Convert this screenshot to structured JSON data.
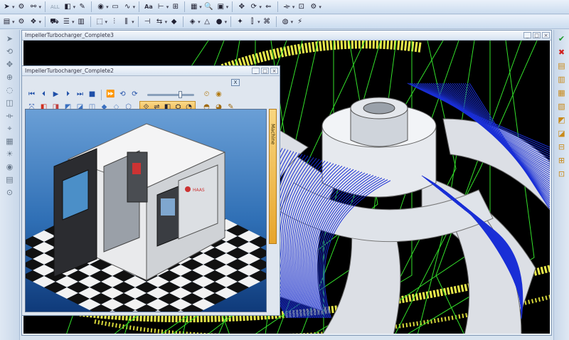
{
  "toolbar1": {
    "items": [
      {
        "name": "pointer-icon",
        "glyph": "➤"
      },
      {
        "name": "select-filter-icon",
        "glyph": "⚙"
      },
      {
        "name": "link-icon",
        "glyph": "⚯"
      },
      {
        "name": "all-filter",
        "glyph": "ALL"
      },
      {
        "name": "curve-icon",
        "glyph": "◧"
      },
      {
        "name": "pen-icon",
        "glyph": "✎"
      },
      {
        "name": "circle-icon",
        "glyph": "◉"
      },
      {
        "name": "rect-icon",
        "glyph": "▭"
      },
      {
        "name": "spline-icon",
        "glyph": "∿"
      },
      {
        "name": "text-tool",
        "glyph": "Aa"
      },
      {
        "name": "split-icon",
        "glyph": "⊢"
      },
      {
        "name": "table-icon",
        "glyph": "⊞"
      },
      {
        "name": "hatch-icon",
        "glyph": "▦"
      },
      {
        "name": "search-icon",
        "glyph": "🔍"
      },
      {
        "name": "layers-icon",
        "glyph": "▣"
      },
      {
        "name": "move-icon",
        "glyph": "✥"
      },
      {
        "name": "refresh-icon",
        "glyph": "⟳"
      },
      {
        "name": "arrow-left-icon",
        "glyph": "⇐"
      },
      {
        "name": "measure-icon",
        "glyph": "⟛"
      },
      {
        "name": "zoom-window-icon",
        "glyph": "⊡"
      },
      {
        "name": "settings-icon",
        "glyph": "⚙"
      }
    ]
  },
  "toolbar2": {
    "items": [
      {
        "name": "layout-icon",
        "glyph": "▤"
      },
      {
        "name": "gear-icon",
        "glyph": "⚙"
      },
      {
        "name": "group-icon",
        "glyph": "❖"
      },
      {
        "name": "car-icon",
        "glyph": "⛟"
      },
      {
        "name": "stack-icon",
        "glyph": "☰"
      },
      {
        "name": "mesh-icon",
        "glyph": "▥"
      },
      {
        "name": "view-icon",
        "glyph": "⬚"
      },
      {
        "name": "align-icon",
        "glyph": "⫶"
      },
      {
        "name": "columns-icon",
        "glyph": "⫼"
      },
      {
        "name": "lock-icon",
        "glyph": "⊣"
      },
      {
        "name": "mirror-icon",
        "glyph": "⇆"
      },
      {
        "name": "cube-icon",
        "glyph": "◆"
      },
      {
        "name": "shade-icon",
        "glyph": "◈"
      },
      {
        "name": "triangle-icon",
        "glyph": "△"
      },
      {
        "name": "record-icon",
        "glyph": "●"
      },
      {
        "name": "sparkle-icon",
        "glyph": "✦"
      },
      {
        "name": "sliders-icon",
        "glyph": "⫿"
      },
      {
        "name": "tree-icon",
        "glyph": "⌘"
      },
      {
        "name": "globe-icon",
        "glyph": "◍"
      },
      {
        "name": "bolt-icon",
        "glyph": "⚡"
      }
    ]
  },
  "main_window": {
    "title": "ImpellerTurbocharger_Complete3",
    "controls": [
      "_",
      "□",
      "×"
    ]
  },
  "sub_window": {
    "title": "ImpellerTurbocharger_Complete2",
    "controls": [
      "_",
      "□",
      "×"
    ],
    "x_button": "X",
    "side_tab": "Machine",
    "playback": [
      {
        "name": "skip-start-icon",
        "glyph": "⏮"
      },
      {
        "name": "step-back-icon",
        "glyph": "⏴"
      },
      {
        "name": "play-icon",
        "glyph": "▶"
      },
      {
        "name": "step-forward-icon",
        "glyph": "⏵"
      },
      {
        "name": "skip-end-icon",
        "glyph": "⏭"
      },
      {
        "name": "stop-icon",
        "glyph": "■"
      },
      {
        "name": "fast-forward-icon",
        "glyph": "⏩"
      },
      {
        "name": "loop-icon",
        "glyph": "⟲"
      },
      {
        "name": "cycle-icon",
        "glyph": "⟳"
      }
    ],
    "views": [
      {
        "name": "fit-view-icon",
        "glyph": "⤧"
      },
      {
        "name": "cube-front-icon",
        "glyph": "◧"
      },
      {
        "name": "cube-top-icon",
        "glyph": "◨"
      },
      {
        "name": "cube-right-icon",
        "glyph": "◩"
      },
      {
        "name": "cube-left-icon",
        "glyph": "◪"
      },
      {
        "name": "cube-back-icon",
        "glyph": "◫"
      },
      {
        "name": "cube-iso-icon",
        "glyph": "◆"
      },
      {
        "name": "cube-bottom-icon",
        "glyph": "◇"
      },
      {
        "name": "cube-wire-icon",
        "glyph": "⬡"
      }
    ],
    "machine": {
      "brand": "HAAS"
    }
  },
  "left_tools": [
    "pointer-tool-icon",
    "rotate-tool-icon",
    "pan-tool-icon",
    "zoom-tool-icon",
    "orbit-tool-icon",
    "section-tool-icon",
    "measure-tool-icon",
    "snap-tool-icon",
    "grid-tool-icon",
    "light-tool-icon",
    "camera-tool-icon",
    "layer-tool-icon",
    "probe-tool-icon"
  ],
  "right_tools": [
    {
      "name": "ok-check-icon",
      "glyph": "✔",
      "color": "#1b9a2a"
    },
    {
      "name": "cancel-x-icon",
      "glyph": "✖",
      "color": "#d0201e"
    },
    {
      "name": "dock-icon-1",
      "glyph": "▤",
      "color": "#c98a1a"
    },
    {
      "name": "dock-icon-2",
      "glyph": "▥",
      "color": "#c98a1a"
    },
    {
      "name": "dock-icon-3",
      "glyph": "▦",
      "color": "#c98a1a"
    },
    {
      "name": "dock-icon-4",
      "glyph": "▧",
      "color": "#c98a1a"
    },
    {
      "name": "dock-icon-5",
      "glyph": "◩",
      "color": "#c98a1a"
    },
    {
      "name": "dock-icon-6",
      "glyph": "◪",
      "color": "#c98a1a"
    },
    {
      "name": "dock-icon-7",
      "glyph": "⊟",
      "color": "#c98a1a"
    },
    {
      "name": "dock-icon-8",
      "glyph": "⊞",
      "color": "#c98a1a"
    },
    {
      "name": "dock-icon-9",
      "glyph": "⊡",
      "color": "#c98a1a"
    }
  ],
  "colors": {
    "toolpath_blue": "#1a2fd6",
    "toolpath_green": "#33e02a",
    "stock_yellow": "#e8e84a",
    "part_gray": "#d8dce2",
    "viewport_bg": "#000000"
  }
}
